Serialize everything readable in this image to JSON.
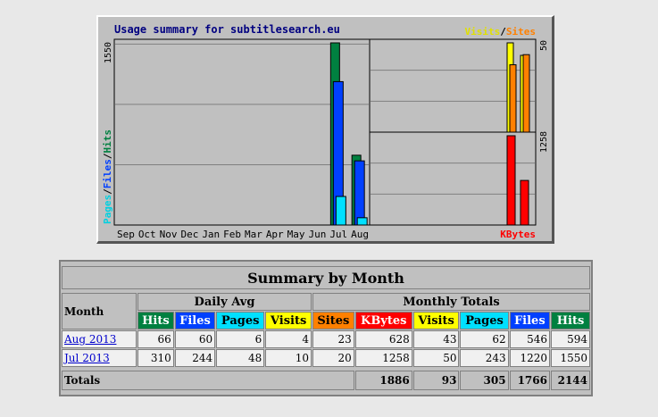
{
  "chart": {
    "title": "Usage summary for subtitlesearch.eu",
    "legend_visits": "Visits",
    "legend_slash": "/",
    "legend_sites": "Sites",
    "legend_kbytes": "KBytes",
    "ylabel_pages": "Pages",
    "ylabel_files": "Files",
    "ylabel_hits": "Hits",
    "max_main": "1550",
    "max_visits": "50",
    "max_kbytes": "1258",
    "colors": {
      "hits": "#008040",
      "files": "#0040ff",
      "pages": "#00e0ff",
      "visits": "#ffff00",
      "sites": "#ff8000",
      "kbytes": "#ff0000"
    }
  },
  "chart_data": {
    "type": "bar",
    "categories": [
      "Sep",
      "Oct",
      "Nov",
      "Dec",
      "Jan",
      "Feb",
      "Mar",
      "Apr",
      "May",
      "Jun",
      "Jul",
      "Aug"
    ],
    "series": [
      {
        "name": "Hits",
        "values": [
          0,
          0,
          0,
          0,
          0,
          0,
          0,
          0,
          0,
          0,
          1550,
          594
        ]
      },
      {
        "name": "Files",
        "values": [
          0,
          0,
          0,
          0,
          0,
          0,
          0,
          0,
          0,
          0,
          1220,
          546
        ]
      },
      {
        "name": "Pages",
        "values": [
          0,
          0,
          0,
          0,
          0,
          0,
          0,
          0,
          0,
          0,
          243,
          62
        ]
      },
      {
        "name": "Visits",
        "values": [
          0,
          0,
          0,
          0,
          0,
          0,
          0,
          0,
          0,
          0,
          50,
          43
        ]
      },
      {
        "name": "Sites",
        "values": [
          0,
          0,
          0,
          0,
          0,
          0,
          0,
          0,
          0,
          0,
          20,
          23
        ]
      },
      {
        "name": "KBytes",
        "values": [
          0,
          0,
          0,
          0,
          0,
          0,
          0,
          0,
          0,
          0,
          1258,
          628
        ]
      }
    ],
    "ylim_main": [
      0,
      1550
    ],
    "ylim_visits": [
      0,
      50
    ],
    "ylim_kbytes": [
      0,
      1258
    ]
  },
  "table": {
    "title": "Summary by Month",
    "month_header": "Month",
    "daily_avg": "Daily Avg",
    "monthly_totals": "Monthly Totals",
    "daily_cols": [
      "Hits",
      "Files",
      "Pages",
      "Visits"
    ],
    "monthly_cols": [
      "Sites",
      "KBytes",
      "Visits",
      "Pages",
      "Files",
      "Hits"
    ],
    "rows": [
      {
        "month": "Aug 2013",
        "d_hits": "66",
        "d_files": "60",
        "d_pages": "6",
        "d_visits": "4",
        "m_sites": "23",
        "m_kbytes": "628",
        "m_visits": "43",
        "m_pages": "62",
        "m_files": "546",
        "m_hits": "594"
      },
      {
        "month": "Jul 2013",
        "d_hits": "310",
        "d_files": "244",
        "d_pages": "48",
        "d_visits": "10",
        "m_sites": "20",
        "m_kbytes": "1258",
        "m_visits": "50",
        "m_pages": "243",
        "m_files": "1220",
        "m_hits": "1550"
      }
    ],
    "totals_label": "Totals",
    "totals": {
      "kbytes": "1886",
      "visits": "93",
      "pages": "305",
      "files": "1766",
      "hits": "2144"
    }
  }
}
